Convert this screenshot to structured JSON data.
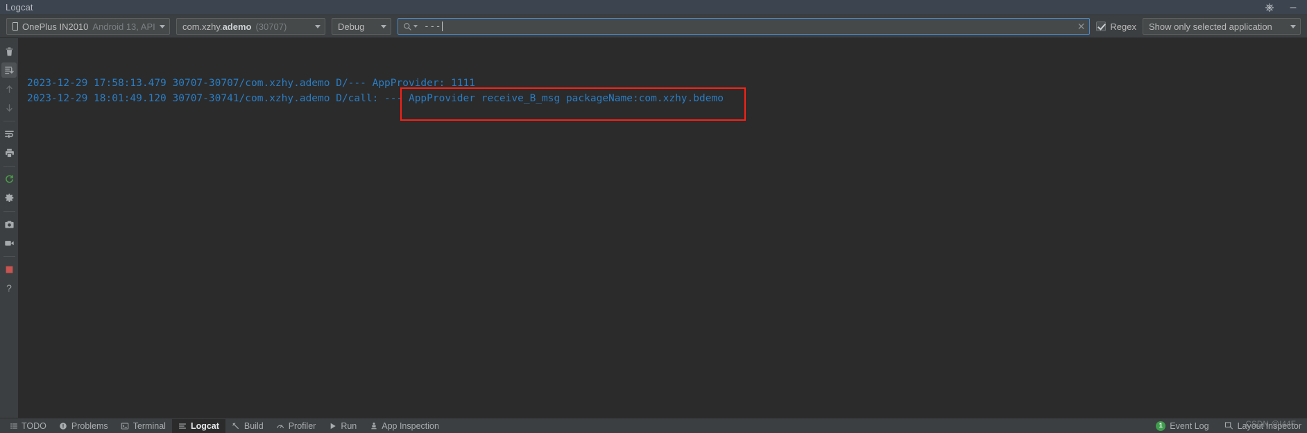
{
  "window": {
    "title": "Logcat",
    "settings_icon": "gear-icon",
    "minimize_icon": "minimize-icon"
  },
  "toolbar": {
    "device": {
      "icon": "phone-icon",
      "name": "OnePlus IN2010",
      "detail": "Android 13, API",
      "caret": "chevron-down-icon"
    },
    "process": {
      "package_prefix": "com.xzhy.",
      "package_name": "ademo",
      "pid": "(30707)",
      "caret": "chevron-down-icon"
    },
    "log_level": {
      "value": "Debug",
      "caret": "chevron-down-icon"
    },
    "search": {
      "icon": "search-icon",
      "value": "---",
      "placeholder": "",
      "clear_icon": "close-icon"
    },
    "regex": {
      "label": "Regex",
      "checked": true
    },
    "scope": {
      "value": "Show only selected application",
      "caret": "chevron-down-icon"
    }
  },
  "gutter": {
    "buttons": [
      {
        "name": "clear-logcat-button",
        "icon": "trash-icon",
        "state": "enabled"
      },
      {
        "name": "scroll-to-end-button",
        "icon": "scroll-to-end-icon",
        "state": "active"
      },
      {
        "name": "previous-occurrence-button",
        "icon": "arrow-up-icon",
        "state": "disabled"
      },
      {
        "name": "next-occurrence-button",
        "icon": "arrow-down-icon",
        "state": "disabled"
      },
      {
        "name": "soft-wrap-button",
        "icon": "soft-wrap-icon",
        "state": "enabled"
      },
      {
        "name": "print-button",
        "icon": "print-icon",
        "state": "enabled"
      },
      {
        "name": "restart-logcat-button",
        "icon": "restart-icon",
        "state": "enabled"
      },
      {
        "name": "settings-button",
        "icon": "gear-icon",
        "state": "enabled"
      },
      {
        "name": "screenshot-button",
        "icon": "camera-icon",
        "state": "enabled"
      },
      {
        "name": "screen-record-button",
        "icon": "video-camera-icon",
        "state": "enabled"
      },
      {
        "name": "stop-button",
        "icon": "stop-square-icon",
        "state": "enabled"
      },
      {
        "name": "help-button",
        "icon": "question-mark-icon",
        "state": "enabled"
      }
    ]
  },
  "log": {
    "text_color": "#2a7dc4",
    "highlight_color": "#fb2116",
    "lines": [
      "2023-12-29 17:58:13.479 30707-30707/com.xzhy.ademo D/--- AppProvider: 1111",
      "2023-12-29 18:01:49.120 30707-30741/com.xzhy.ademo D/call: --- AppProvider receive_B_msg packageName:com.xzhy.bdemo"
    ]
  },
  "statusbar": {
    "tabs": [
      {
        "label": "TODO",
        "icon": "list-icon",
        "selected": false
      },
      {
        "label": "Problems",
        "icon": "warning-circle-icon",
        "selected": false
      },
      {
        "label": "Terminal",
        "icon": "terminal-icon",
        "selected": false
      },
      {
        "label": "Logcat",
        "icon": "logcat-icon",
        "selected": true
      },
      {
        "label": "Build",
        "icon": "hammer-icon",
        "selected": false
      },
      {
        "label": "Profiler",
        "icon": "profiler-icon",
        "selected": false
      },
      {
        "label": "Run",
        "icon": "play-icon",
        "selected": false
      },
      {
        "label": "App Inspection",
        "icon": "app-inspection-icon",
        "selected": false
      }
    ],
    "event_log": {
      "count": "1",
      "label": "Event Log"
    },
    "layout_inspector": {
      "label": "Layout Inspector",
      "icon": "layout-inspector-icon"
    },
    "watermark": "CSDN @I44F"
  }
}
